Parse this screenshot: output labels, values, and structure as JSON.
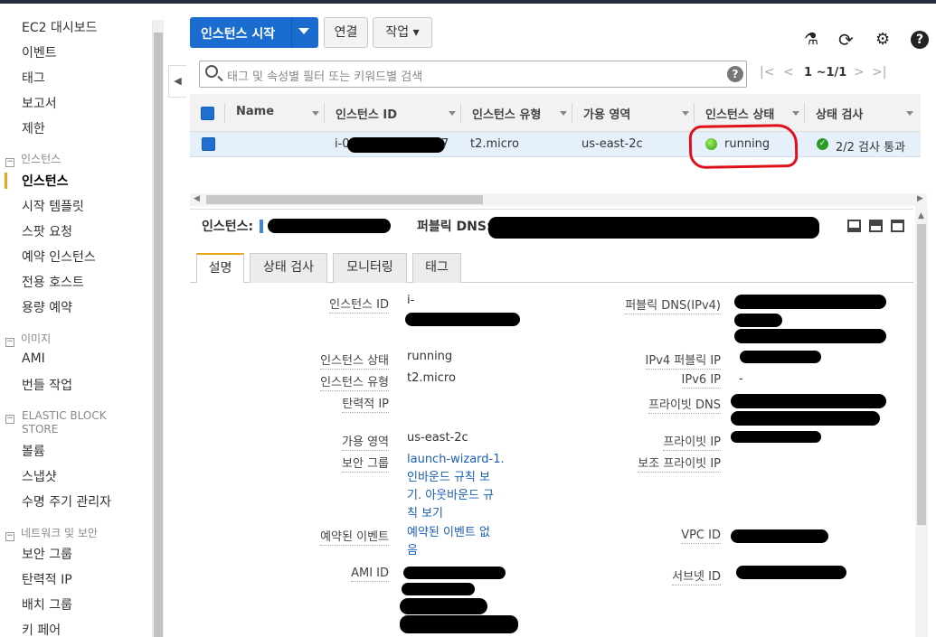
{
  "sidebar": {
    "items": [
      "EC2 대시보드",
      "이벤트",
      "태그",
      "보고서",
      "제한",
      "인스턴스",
      "시작 템플릿",
      "스팟 요청",
      "예약 인스턴스",
      "전용 호스트",
      "용량 예약",
      "AMI",
      "번들 작업",
      "볼륨",
      "스냅샷",
      "수명 주기 관리자",
      "보안 그룹",
      "탄력적 IP",
      "배치 그룹",
      "키 페어"
    ],
    "sections": {
      "instances": "인스턴스",
      "images": "이미지",
      "ebs_line1": "ELASTIC BLOCK",
      "ebs_line2": "STORE",
      "network": "네트워크 및 보안"
    },
    "collapse_icon": "◀",
    "section_toggle": "−"
  },
  "toolbar": {
    "launch_label": "인스턴스 시작",
    "connect_label": "연결",
    "actions_label": "작업 ▾",
    "icons": {
      "flask": "⚗",
      "refresh": "⟳",
      "gear": "⚙",
      "help": "?"
    }
  },
  "search": {
    "placeholder": "태그 및 속성별 필터 또는 키워드별 검색",
    "help": "?"
  },
  "pager": {
    "first": "|<",
    "prev": "<",
    "text": "1 ~1/1",
    "next": ">",
    "last": ">|"
  },
  "table": {
    "columns": [
      "Name",
      "인스턴스 ID",
      "인스턴스 유형",
      "가용 영역",
      "인스턴스 상태",
      "상태 검사"
    ],
    "row": {
      "id_prefix": "i-0",
      "id_suffix": "7",
      "type": "t2.micro",
      "zone": "us-east-2c",
      "state": "running",
      "check": "2/2 검사 통과",
      "check_mark": "✓"
    }
  },
  "summary": {
    "instance_label": "인스턴스:",
    "public_dns_label": "퍼블릭 DNS:"
  },
  "tabs": [
    "설명",
    "상태 검사",
    "모니터링",
    "태그"
  ],
  "details": {
    "left": {
      "instance_id": {
        "label": "인스턴스 ID",
        "value": "i-"
      },
      "state": {
        "label": "인스턴스 상태",
        "value": "running"
      },
      "type": {
        "label": "인스턴스 유형",
        "value": "t2.micro"
      },
      "eip": {
        "label": "탄력적 IP",
        "value": ""
      },
      "az": {
        "label": "가용 영역",
        "value": "us-east-2c"
      },
      "sg": {
        "label": "보안 그룹",
        "value": "launch-wizard-1.",
        "links": [
          "인바운드 규칙 보",
          "기. 아웃바운드 규",
          "칙 보기"
        ]
      },
      "events": {
        "label": "예약된 이벤트",
        "lines": [
          "예약된 이벤트 없",
          "음"
        ]
      },
      "ami": {
        "label": "AMI ID"
      }
    },
    "right": {
      "public_dns": {
        "label": "퍼블릭 DNS(IPv4)"
      },
      "public_ip": {
        "label": "IPv4 퍼블릭 IP"
      },
      "ipv6": {
        "label": "IPv6 IP",
        "value": "-"
      },
      "private_dns": {
        "label": "프라이빗 DNS"
      },
      "private_ip": {
        "label": "프라이빗 IP"
      },
      "secondary_ip": {
        "label": "보조 프라이빗 IP"
      },
      "vpc": {
        "label": "VPC ID"
      },
      "subnet": {
        "label": "서브넷 ID"
      }
    }
  },
  "colors": {
    "primary": "#1a6dcf",
    "running": "#2e9a12",
    "highlight": "#e0101a",
    "tab_accent": "#e7a81a"
  }
}
